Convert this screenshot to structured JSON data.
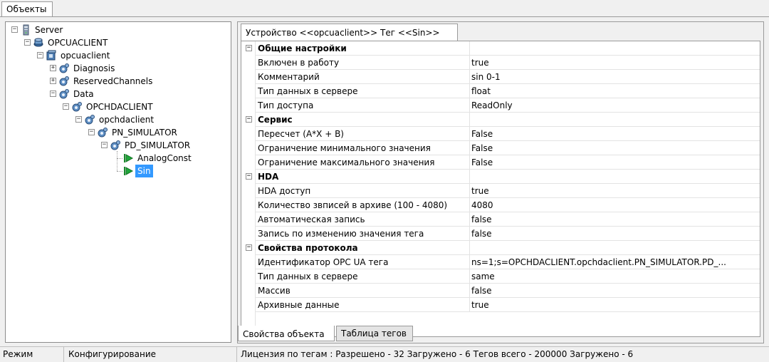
{
  "top_tab": "Объекты",
  "tree": [
    {
      "label": "Server",
      "icon": "server-icon",
      "exp": "−",
      "level": 0
    },
    {
      "label": "OPCUACLIENT",
      "icon": "client-driver-icon",
      "exp": "−",
      "level": 1
    },
    {
      "label": "opcuaclient",
      "icon": "device-icon",
      "exp": "−",
      "level": 2
    },
    {
      "label": "Diagnosis",
      "icon": "group-icon",
      "exp": "+",
      "level": 3
    },
    {
      "label": "ReservedChannels",
      "icon": "group-icon",
      "exp": "+",
      "level": 3
    },
    {
      "label": "Data",
      "icon": "group-icon",
      "exp": "−",
      "level": 3
    },
    {
      "label": "OPCHDACLIENT",
      "icon": "group-icon",
      "exp": "−",
      "level": 4
    },
    {
      "label": "opchdaclient",
      "icon": "group-icon",
      "exp": "−",
      "level": 5
    },
    {
      "label": "PN_SIMULATOR",
      "icon": "group-icon",
      "exp": "−",
      "level": 6
    },
    {
      "label": "PD_SIMULATOR",
      "icon": "group-icon",
      "exp": "−",
      "level": 7
    },
    {
      "label": "AnalogConst",
      "icon": "tag-arrow-icon",
      "exp": "",
      "level": 8
    },
    {
      "label": "Sin",
      "icon": "tag-arrow-icon",
      "exp": "",
      "level": 8,
      "selected": true
    }
  ],
  "prop_tab": "Устройство <<opcuaclient>> Тег  <<Sin>>",
  "grid": [
    {
      "cat": true,
      "name": "Общие настройки"
    },
    {
      "name": "Включен в работу",
      "value": "true"
    },
    {
      "name": "Комментарий",
      "value": "sin 0-1"
    },
    {
      "name": "Тип данных в сервере",
      "value": "float"
    },
    {
      "name": "Тип доступа",
      "value": "ReadOnly"
    },
    {
      "cat": true,
      "name": "Сервис"
    },
    {
      "name": "Пересчет (A*X + B)",
      "value": "False"
    },
    {
      "name": "Ограничение минимального значения",
      "value": "False"
    },
    {
      "name": "Ограничение максимального значения",
      "value": "False"
    },
    {
      "cat": true,
      "name": "HDA"
    },
    {
      "name": "HDA доступ",
      "value": "true"
    },
    {
      "name": "Количество звписей в архиве (100 - 4080)",
      "value": "4080"
    },
    {
      "name": "Автоматическая запись",
      "value": "false"
    },
    {
      "name": "Запись по изменению значения тега",
      "value": "false"
    },
    {
      "cat": true,
      "name": "Свойства протокола"
    },
    {
      "name": "Идентификатор OPC UA тега",
      "value": "ns=1;s=OPCHDACLIENT.opchdaclient.PN_SIMULATOR.PD_..."
    },
    {
      "name": "Тип данных в сервере",
      "value": "same"
    },
    {
      "name": "Массив",
      "value": "false"
    },
    {
      "name": "Архивные данные",
      "value": "true"
    }
  ],
  "bottom_tabs": {
    "active": "Свойства объекта",
    "inactive": "Таблица тегов"
  },
  "status": {
    "mode_label": "Режим",
    "mode_value": "Конфигурирование",
    "license": "Лицензия по тегам : Разрешено - 32 Загружено - 6 Тегов всего - 200000 Загружено - 6"
  }
}
